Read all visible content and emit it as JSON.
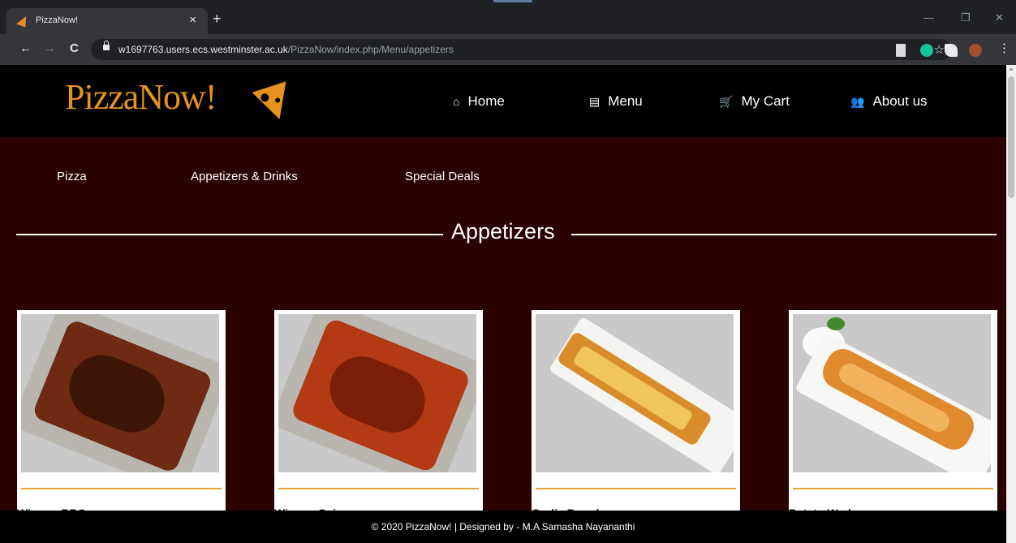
{
  "browser": {
    "tab_title": "PizzaNow!",
    "tab_close": "×",
    "new_tab": "+",
    "url_host": "w1697763.users.ecs.westminster.ac.uk",
    "url_path": "/PizzaNow/index.php/Menu/appetizers",
    "back": "←",
    "forward": "→",
    "reload": "C",
    "star": "☆",
    "minimize": "—",
    "restore": "❐",
    "close": "✕",
    "menu": "⋮"
  },
  "site": {
    "logo": "PizzaNow!",
    "nav": [
      {
        "icon": "⌂",
        "label": "Home"
      },
      {
        "icon": "▤",
        "label": "Menu"
      },
      {
        "icon": "🛒",
        "label": "My Cart"
      },
      {
        "icon": "👥",
        "label": "About us"
      }
    ],
    "categories": [
      "Pizza",
      "Appetizers & Drinks",
      "Special Deals"
    ],
    "section_title": "Appetizers",
    "cards": [
      {
        "name": "Wings - BBQ"
      },
      {
        "name": "Wings - Spicy"
      },
      {
        "name": "Garlic Bread"
      },
      {
        "name": "Potato Wedges"
      }
    ],
    "footer": "© 2020 PizzaNow! | Designed by - M.A Samasha Nayananthi"
  },
  "colors": {
    "accent": "#e6921e",
    "page_bg": "#2a0202",
    "header_bg": "#000000",
    "card_rule": "#e5a531"
  }
}
